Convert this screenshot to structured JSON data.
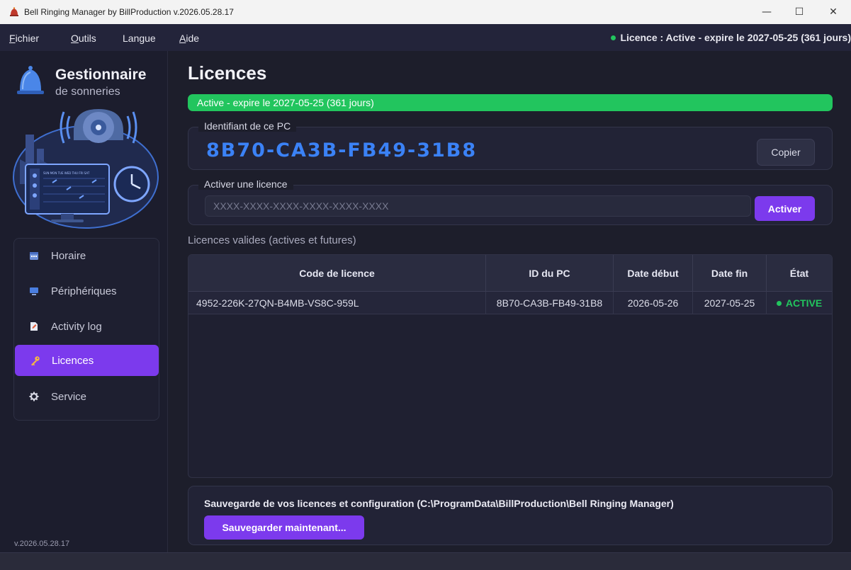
{
  "window": {
    "title": "Bell Ringing Manager by BillProduction  v.2026.05.28.17",
    "minimize_glyph": "—",
    "maximize_glyph": "☐",
    "close_glyph": "✕"
  },
  "menu": {
    "items": [
      {
        "underline": "F",
        "rest": "ichier"
      },
      {
        "underline": "O",
        "rest": "utils"
      },
      {
        "underline": "",
        "rest": "Langue"
      },
      {
        "underline": "A",
        "rest": "ide"
      }
    ],
    "license_status": "Licence : Active - expire le 2027-05-25 (361 jours)",
    "status_color": "#22c55e"
  },
  "sidebar": {
    "brand_title": "Gestionnaire",
    "brand_subtitle": "de sonneries",
    "illustration_days": "SUN MON TUE WED THU FRI SAT",
    "nav": [
      {
        "label": "Horaire",
        "icon": "calendar-icon"
      },
      {
        "label": "Périphériques",
        "icon": "monitor-icon"
      },
      {
        "label": "Activity log",
        "icon": "log-icon"
      },
      {
        "label": "Licences",
        "icon": "key-icon",
        "active": true
      },
      {
        "label": "Service",
        "icon": "gear-icon"
      }
    ],
    "version": "v.2026.05.28.17"
  },
  "main": {
    "title": "Licences",
    "status_banner": "Active - expire le 2027-05-25 (361 jours)",
    "pc_id_group_label": "Identifiant de ce PC",
    "pc_id": "8B70-CA3B-FB49-31B8",
    "copy_button": "Copier",
    "activate_group_label": "Activer une licence",
    "license_input_placeholder": "XXXX-XXXX-XXXX-XXXX-XXXX-XXXX",
    "license_input_value": "",
    "activate_button": "Activer",
    "table_caption": "Licences valides (actives et futures)",
    "table": {
      "columns": [
        "Code de licence",
        "ID du PC",
        "Date début",
        "Date fin",
        "État"
      ],
      "rows": [
        {
          "code": "4952-226K-27QN-B4MB-VS8C-959L",
          "pc_id": "8B70-CA3B-FB49-31B8",
          "start": "2026-05-26",
          "end": "2027-05-25",
          "state": "ACTIVE"
        }
      ]
    },
    "backup_label": "Sauvegarde de vos licences et configuration  (C:\\ProgramData\\BillProduction\\Bell Ringing Manager)",
    "backup_button": "Sauvegarder maintenant..."
  },
  "colors": {
    "accent": "#7c3aed",
    "success": "#22c55e",
    "pc_id": "#3b82f6",
    "background": "#1d1e2b"
  }
}
